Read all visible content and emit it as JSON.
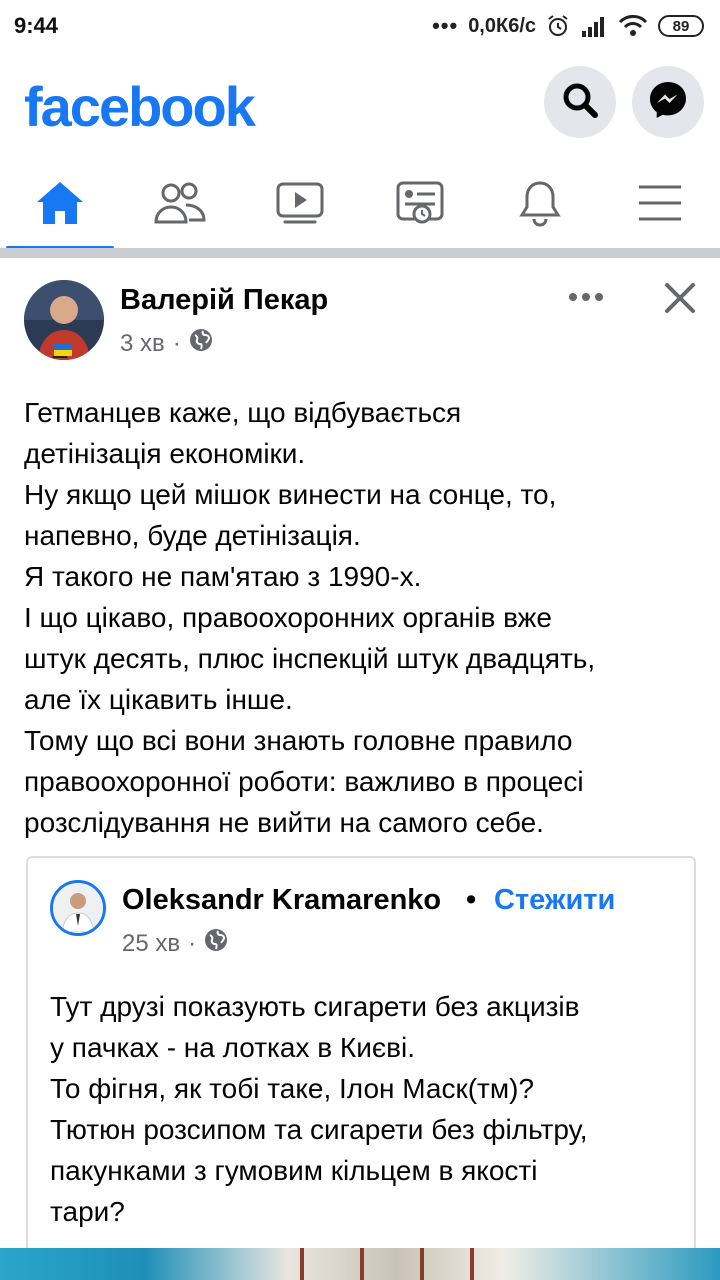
{
  "status_bar": {
    "time": "9:44",
    "dots": "•••",
    "network_speed": "0,0К6/с",
    "battery": "89"
  },
  "header": {
    "logo": "facebook",
    "brand_color": "#1877f2",
    "icons": [
      "search-icon",
      "messenger-icon"
    ]
  },
  "nav": {
    "tabs": [
      {
        "name": "home",
        "icon": "home-icon",
        "active": true
      },
      {
        "name": "friends",
        "icon": "friends-icon",
        "active": false
      },
      {
        "name": "watch",
        "icon": "watch-icon",
        "active": false
      },
      {
        "name": "news",
        "icon": "news-icon",
        "active": false
      },
      {
        "name": "notifications",
        "icon": "bell-icon",
        "active": false
      },
      {
        "name": "menu",
        "icon": "menu-icon",
        "active": false
      }
    ]
  },
  "post": {
    "author": "Валерій Пекар",
    "time": "3 хв",
    "separator": "·",
    "lines": [
      "Гетманцев каже, що відбувається",
      "детінізація економіки.",
      "Ну якщо цей мішок винести на сонце, то,",
      "напевно, буде детінізація.",
      "Я такого не пам'ятаю з 1990-х.",
      "І що цікаво, правоохоронних органів вже",
      "штук десять, плюс інспекцій штук двадцять,",
      "але їх цікавить інше.",
      "Тому що всі вони знають головне правило",
      "правоохоронної роботи: важливо в процесі",
      "розслідування не вийти на самого себе."
    ]
  },
  "shared_post": {
    "author": "Oleksandr Kramarenko",
    "dot": "•",
    "follow_label": "Стежити",
    "time": "25 хв",
    "separator": "·",
    "lines": [
      "Тут друзі показують сигарети без акцизів",
      "у пачках - на лотках в Києві.",
      "То фігня, як тобі таке, Ілон Маск(тм)?",
      "Тютюн розсипом та сигарети без фільтру,",
      "пакунками з гумовим кільцем в якості",
      "тари?"
    ]
  }
}
